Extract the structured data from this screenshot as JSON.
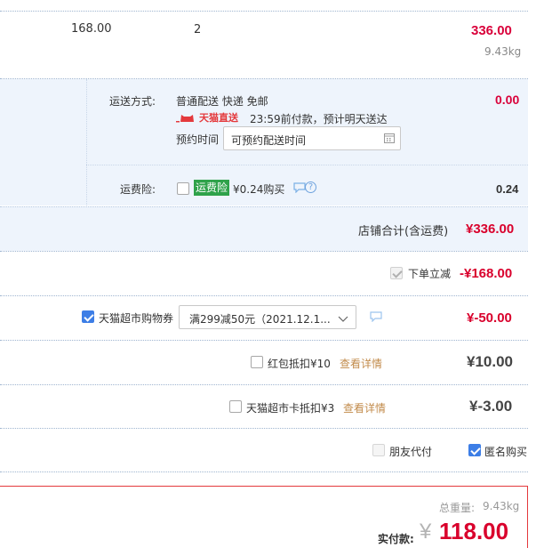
{
  "item": {
    "unit_price": "168.00",
    "quantity": "2",
    "subtotal": "336.00",
    "weight": "9.43kg"
  },
  "shipping": {
    "label": "运送方式:",
    "method": "普通配送 快递 免邮",
    "badge": "天猫直送",
    "promise": "23:59前付款，预计明天送达",
    "reserve_label": "预约时间",
    "reserve_placeholder": "可预约配送时间",
    "fee": "0.00"
  },
  "insurance": {
    "label": "运费险:",
    "badge": "运费险",
    "price_text": "¥0.24购买",
    "fee": "0.24"
  },
  "store_total": {
    "label": "店铺合计(含运费)",
    "amount": "¥336.00"
  },
  "discount": {
    "label": "下单立减",
    "amount": "-¥168.00"
  },
  "coupon": {
    "label": "天猫超市购物券",
    "selected": "满299减50元（2021.12.1...",
    "amount": "¥-50.00"
  },
  "red_packet": {
    "label": "红包抵扣¥10",
    "link": "查看详情",
    "amount": "¥10.00"
  },
  "supermarket_card": {
    "label": "天猫超市卡抵扣¥3",
    "link": "查看详情",
    "amount": "¥-3.00"
  },
  "options": {
    "friend_pay": "朋友代付",
    "anonymous": "匿名购买"
  },
  "summary": {
    "weight_label": "总重量:",
    "weight": "9.43kg",
    "pay_label": "实付款:",
    "currency": "¥",
    "pay_amount": "118.00"
  },
  "colors": {
    "accent_red": "#d9002c",
    "check_blue": "#3d7ee6",
    "panel_blue": "#eef4fc",
    "link_gold": "#c28b4b",
    "badge_green": "#2fa24a"
  }
}
